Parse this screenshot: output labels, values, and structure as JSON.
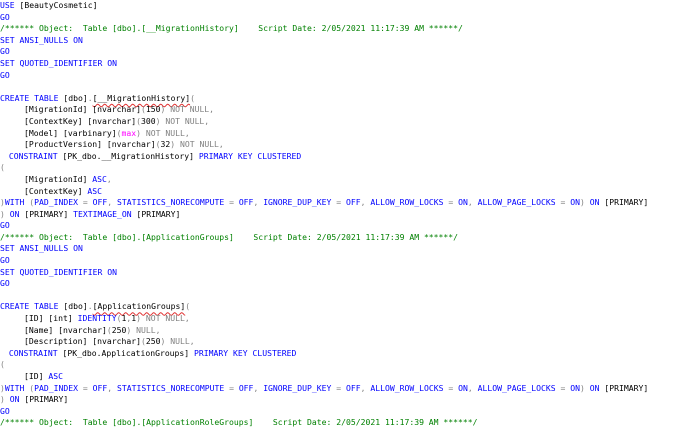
{
  "editor": {
    "lines": [
      {
        "parts": [
          {
            "c": "kw",
            "t": "USE "
          },
          {
            "c": "tx",
            "t": "[BeautyCosmetic]"
          }
        ]
      },
      {
        "parts": [
          {
            "c": "kw",
            "t": "GO"
          }
        ]
      },
      {
        "parts": [
          {
            "c": "cm",
            "t": "/****** Object:  Table [dbo].[__MigrationHistory]    Script Date: 2/05/2021 11:17:39 AM ******/"
          }
        ]
      },
      {
        "parts": [
          {
            "c": "kw",
            "t": "SET ANSI_NULLS ON"
          }
        ]
      },
      {
        "parts": [
          {
            "c": "kw",
            "t": "GO"
          }
        ]
      },
      {
        "parts": [
          {
            "c": "kw",
            "t": "SET QUOTED_IDENTIFIER ON"
          }
        ]
      },
      {
        "parts": [
          {
            "c": "kw",
            "t": "GO"
          }
        ]
      },
      {
        "parts": []
      },
      {
        "parts": [
          {
            "c": "kw",
            "t": "CREATE TABLE "
          },
          {
            "c": "tx",
            "t": "[dbo]"
          },
          {
            "c": "gr",
            "t": "."
          },
          {
            "c": "tx sq",
            "t": "[__MigrationHistory]"
          },
          {
            "c": "gr",
            "t": "("
          }
        ]
      },
      {
        "indent": 1,
        "parts": [
          {
            "c": "tx",
            "t": "[MigrationId] [nvarchar]"
          },
          {
            "c": "gr",
            "t": "("
          },
          {
            "c": "tx",
            "t": "150"
          },
          {
            "c": "gr",
            "t": ")"
          },
          {
            "c": "gr",
            "t": " NOT NULL,"
          }
        ]
      },
      {
        "indent": 1,
        "parts": [
          {
            "c": "tx",
            "t": "[ContextKey] [nvarchar]"
          },
          {
            "c": "gr",
            "t": "("
          },
          {
            "c": "tx",
            "t": "300"
          },
          {
            "c": "gr",
            "t": ")"
          },
          {
            "c": "gr",
            "t": " NOT NULL,"
          }
        ]
      },
      {
        "indent": 1,
        "parts": [
          {
            "c": "tx",
            "t": "[Model] [varbinary]"
          },
          {
            "c": "gr",
            "t": "("
          },
          {
            "c": "mg",
            "t": "max"
          },
          {
            "c": "gr",
            "t": ")"
          },
          {
            "c": "gr",
            "t": " NOT NULL,"
          }
        ]
      },
      {
        "indent": 1,
        "parts": [
          {
            "c": "tx",
            "t": "[ProductVersion] [nvarchar]"
          },
          {
            "c": "gr",
            "t": "("
          },
          {
            "c": "tx",
            "t": "32"
          },
          {
            "c": "gr",
            "t": ")"
          },
          {
            "c": "gr",
            "t": " NOT NULL,"
          }
        ]
      },
      {
        "indent": 0,
        "parts": [
          {
            "c": "kw",
            "t": " CONSTRAINT "
          },
          {
            "c": "tx",
            "t": "[PK_dbo.__MigrationHistory]"
          },
          {
            "c": "kw",
            "t": " PRIMARY KEY CLUSTERED"
          }
        ]
      },
      {
        "parts": [
          {
            "c": "gr",
            "t": "("
          }
        ]
      },
      {
        "indent": 1,
        "parts": [
          {
            "c": "tx",
            "t": "[MigrationId]"
          },
          {
            "c": "kw",
            "t": " ASC"
          },
          {
            "c": "gr",
            "t": ","
          }
        ]
      },
      {
        "indent": 1,
        "parts": [
          {
            "c": "tx",
            "t": "[ContextKey]"
          },
          {
            "c": "kw",
            "t": " ASC"
          }
        ]
      },
      {
        "parts": [
          {
            "c": "gr",
            "t": ")"
          },
          {
            "c": "kw",
            "t": "WITH "
          },
          {
            "c": "gr",
            "t": "("
          },
          {
            "c": "kw",
            "t": "PAD_INDEX "
          },
          {
            "c": "gr",
            "t": "= "
          },
          {
            "c": "kw",
            "t": "OFF"
          },
          {
            "c": "gr",
            "t": ", "
          },
          {
            "c": "kw",
            "t": "STATISTICS_NORECOMPUTE "
          },
          {
            "c": "gr",
            "t": "= "
          },
          {
            "c": "kw",
            "t": "OFF"
          },
          {
            "c": "gr",
            "t": ", "
          },
          {
            "c": "kw",
            "t": "IGNORE_DUP_KEY "
          },
          {
            "c": "gr",
            "t": "= "
          },
          {
            "c": "kw",
            "t": "OFF"
          },
          {
            "c": "gr",
            "t": ", "
          },
          {
            "c": "kw",
            "t": "ALLOW_ROW_LOCKS "
          },
          {
            "c": "gr",
            "t": "= "
          },
          {
            "c": "kw",
            "t": "ON"
          },
          {
            "c": "gr",
            "t": ", "
          },
          {
            "c": "kw",
            "t": "ALLOW_PAGE_LOCKS "
          },
          {
            "c": "gr",
            "t": "= "
          },
          {
            "c": "kw",
            "t": "ON"
          },
          {
            "c": "gr",
            "t": ") "
          },
          {
            "c": "kw",
            "t": "ON "
          },
          {
            "c": "tx",
            "t": "[PRIMARY]"
          }
        ]
      },
      {
        "parts": [
          {
            "c": "gr",
            "t": ") "
          },
          {
            "c": "kw",
            "t": "ON "
          },
          {
            "c": "tx",
            "t": "[PRIMARY]"
          },
          {
            "c": "kw",
            "t": " TEXTIMAGE_ON "
          },
          {
            "c": "tx",
            "t": "[PRIMARY]"
          }
        ]
      },
      {
        "parts": [
          {
            "c": "kw",
            "t": "GO"
          }
        ]
      },
      {
        "parts": [
          {
            "c": "cm",
            "t": "/****** Object:  Table [dbo].[ApplicationGroups]    Script Date: 2/05/2021 11:17:39 AM ******/"
          }
        ]
      },
      {
        "parts": [
          {
            "c": "kw",
            "t": "SET ANSI_NULLS ON"
          }
        ]
      },
      {
        "parts": [
          {
            "c": "kw",
            "t": "GO"
          }
        ]
      },
      {
        "parts": [
          {
            "c": "kw",
            "t": "SET QUOTED_IDENTIFIER ON"
          }
        ]
      },
      {
        "parts": [
          {
            "c": "kw",
            "t": "GO"
          }
        ]
      },
      {
        "parts": []
      },
      {
        "parts": [
          {
            "c": "kw",
            "t": "CREATE TABLE "
          },
          {
            "c": "tx",
            "t": "[dbo]"
          },
          {
            "c": "gr",
            "t": "."
          },
          {
            "c": "tx sq",
            "t": "[ApplicationGroups]"
          },
          {
            "c": "gr",
            "t": "("
          }
        ]
      },
      {
        "indent": 1,
        "parts": [
          {
            "c": "tx",
            "t": "[ID] [int] "
          },
          {
            "c": "kw",
            "t": "IDENTITY"
          },
          {
            "c": "gr",
            "t": "("
          },
          {
            "c": "tx",
            "t": "1"
          },
          {
            "c": "gr",
            "t": ","
          },
          {
            "c": "tx",
            "t": "1"
          },
          {
            "c": "gr",
            "t": ")"
          },
          {
            "c": "gr",
            "t": " NOT NULL,"
          }
        ]
      },
      {
        "indent": 1,
        "parts": [
          {
            "c": "tx",
            "t": "[Name] [nvarchar]"
          },
          {
            "c": "gr",
            "t": "("
          },
          {
            "c": "tx",
            "t": "250"
          },
          {
            "c": "gr",
            "t": ")"
          },
          {
            "c": "gr",
            "t": " NULL,"
          }
        ]
      },
      {
        "indent": 1,
        "parts": [
          {
            "c": "tx",
            "t": "[Description] [nvarchar]"
          },
          {
            "c": "gr",
            "t": "("
          },
          {
            "c": "tx",
            "t": "250"
          },
          {
            "c": "gr",
            "t": ")"
          },
          {
            "c": "gr",
            "t": " NULL,"
          }
        ]
      },
      {
        "indent": 0,
        "parts": [
          {
            "c": "kw",
            "t": " CONSTRAINT "
          },
          {
            "c": "tx",
            "t": "[PK_dbo.ApplicationGroups]"
          },
          {
            "c": "kw",
            "t": " PRIMARY KEY CLUSTERED"
          }
        ]
      },
      {
        "parts": [
          {
            "c": "gr",
            "t": "("
          }
        ]
      },
      {
        "indent": 1,
        "parts": [
          {
            "c": "tx",
            "t": "[ID]"
          },
          {
            "c": "kw",
            "t": " ASC"
          }
        ]
      },
      {
        "parts": [
          {
            "c": "gr",
            "t": ")"
          },
          {
            "c": "kw",
            "t": "WITH "
          },
          {
            "c": "gr",
            "t": "("
          },
          {
            "c": "kw",
            "t": "PAD_INDEX "
          },
          {
            "c": "gr",
            "t": "= "
          },
          {
            "c": "kw",
            "t": "OFF"
          },
          {
            "c": "gr",
            "t": ", "
          },
          {
            "c": "kw",
            "t": "STATISTICS_NORECOMPUTE "
          },
          {
            "c": "gr",
            "t": "= "
          },
          {
            "c": "kw",
            "t": "OFF"
          },
          {
            "c": "gr",
            "t": ", "
          },
          {
            "c": "kw",
            "t": "IGNORE_DUP_KEY "
          },
          {
            "c": "gr",
            "t": "= "
          },
          {
            "c": "kw",
            "t": "OFF"
          },
          {
            "c": "gr",
            "t": ", "
          },
          {
            "c": "kw",
            "t": "ALLOW_ROW_LOCKS "
          },
          {
            "c": "gr",
            "t": "= "
          },
          {
            "c": "kw",
            "t": "ON"
          },
          {
            "c": "gr",
            "t": ", "
          },
          {
            "c": "kw",
            "t": "ALLOW_PAGE_LOCKS "
          },
          {
            "c": "gr",
            "t": "= "
          },
          {
            "c": "kw",
            "t": "ON"
          },
          {
            "c": "gr",
            "t": ") "
          },
          {
            "c": "kw",
            "t": "ON "
          },
          {
            "c": "tx",
            "t": "[PRIMARY]"
          }
        ]
      },
      {
        "parts": [
          {
            "c": "gr",
            "t": ") "
          },
          {
            "c": "kw",
            "t": "ON "
          },
          {
            "c": "tx",
            "t": "[PRIMARY]"
          }
        ]
      },
      {
        "parts": [
          {
            "c": "kw",
            "t": "GO"
          }
        ]
      },
      {
        "parts": [
          {
            "c": "cm",
            "t": "/****** Object:  Table [dbo].[ApplicationRoleGroups]    Script Date: 2/05/2021 11:17:39 AM ******/"
          }
        ]
      }
    ]
  },
  "colors": {
    "keyword": "#0000ff",
    "comment": "#008000",
    "operator": "#808080",
    "function": "#ff00ff",
    "text": "#000000",
    "background": "#ffffff"
  }
}
